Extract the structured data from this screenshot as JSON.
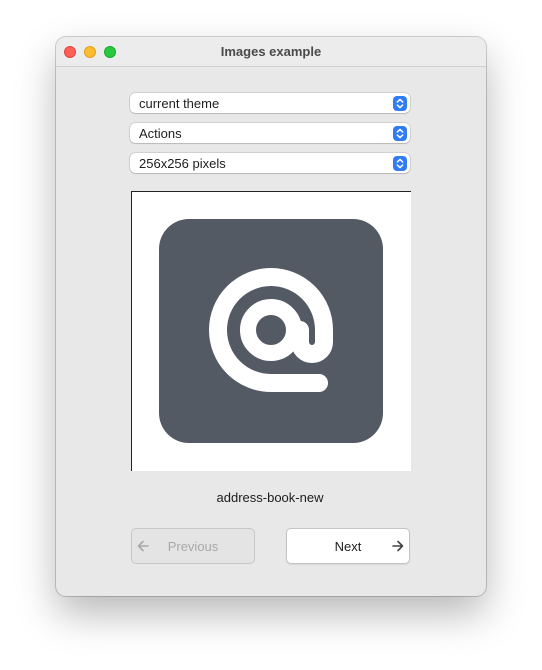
{
  "window": {
    "title": "Images example"
  },
  "combos": {
    "theme": "current theme",
    "context": "Actions",
    "size": "256x256 pixels"
  },
  "image": {
    "icon": "at-sign-icon",
    "caption": "address-book-new"
  },
  "buttons": {
    "previous": "Previous",
    "next": "Next"
  },
  "colors": {
    "accent": "#2f7cf6",
    "icon_tile": "#545a64",
    "window_bg": "#e8e8e8"
  }
}
